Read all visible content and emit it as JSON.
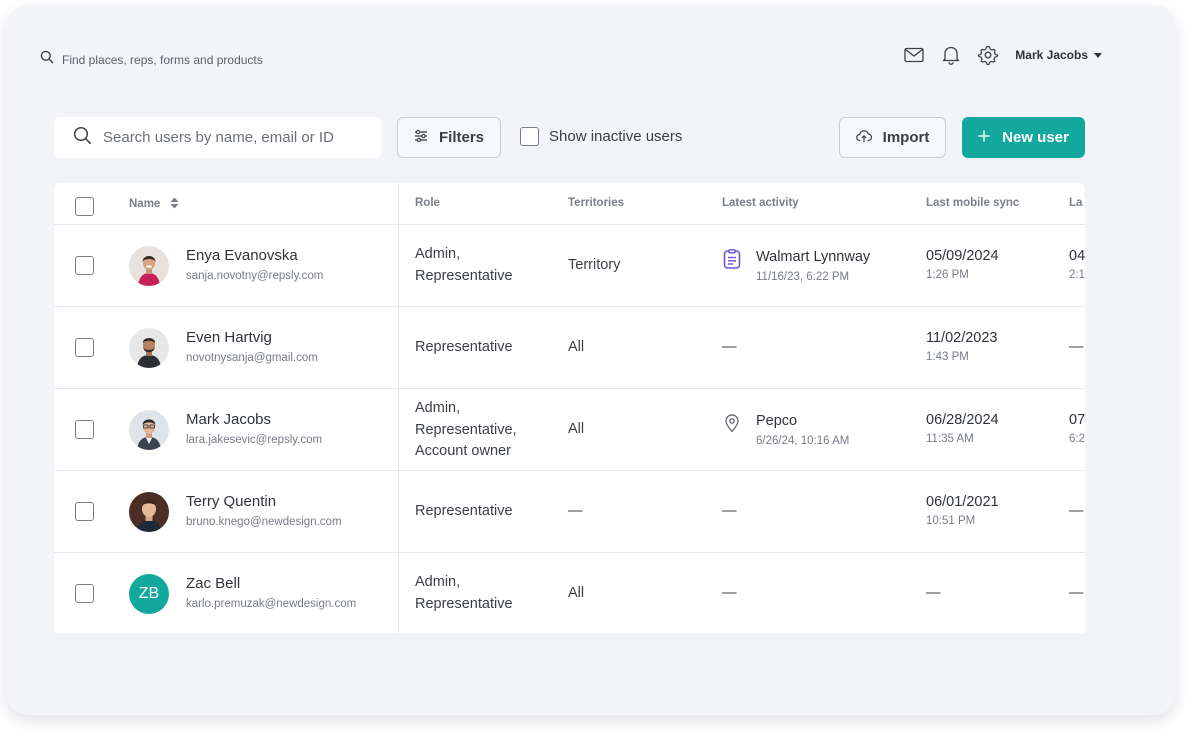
{
  "topbar": {
    "search_placeholder": "Find places, reps, forms and products",
    "user_name": "Mark Jacobs",
    "icons": [
      "mail-icon",
      "bell-icon",
      "gear-icon"
    ]
  },
  "toolbar": {
    "search_placeholder": "Search users by name, email or ID",
    "filters_label": "Filters",
    "inactive_label": "Show inactive users",
    "import_label": "Import",
    "new_user_label": "New user",
    "accent_color": "#13a89e"
  },
  "table": {
    "columns": {
      "name": "Name",
      "role": "Role",
      "territories": "Territories",
      "latest_activity": "Latest activity",
      "last_mobile_sync": "Last mobile sync",
      "last_col_partial": "La"
    },
    "rows": [
      {
        "name": "Enya Evanovska",
        "email": "sanja.novotny@repsly.com",
        "role_lines": [
          "Admin,",
          "Representative"
        ],
        "territories": "Territory",
        "activity": {
          "icon": "form-icon",
          "name": "Walmart Lynnway",
          "time": "11/16/23, 6:22 PM"
        },
        "sync": {
          "date": "05/09/2024",
          "time": "1:26 PM"
        },
        "last": {
          "date": "04",
          "time": "2:1"
        }
      },
      {
        "name": "Even Hartvig",
        "email": "novotnysanja@gmail.com",
        "role_lines": [
          "Representative"
        ],
        "territories": "All",
        "activity_dash": "—",
        "sync": {
          "date": "11/02/2023",
          "time": "1:43 PM"
        },
        "last_dash": "—"
      },
      {
        "name": "Mark Jacobs",
        "email": "lara.jakesevic@repsly.com",
        "role_lines": [
          "Admin,",
          "Representative,",
          "Account owner"
        ],
        "territories": "All",
        "activity": {
          "icon": "location-pin-icon",
          "name": "Pepco",
          "time": "6/26/24, 10:16 AM"
        },
        "sync": {
          "date": "06/28/2024",
          "time": "11:35 AM"
        },
        "last": {
          "date": "07",
          "time": "6:2"
        }
      },
      {
        "name": "Terry Quentin",
        "email": "bruno.knego@newdesign.com",
        "role_lines": [
          "Representative"
        ],
        "territories_dash": "—",
        "activity_dash": "—",
        "sync": {
          "date": "06/01/2021",
          "time": "10:51 PM"
        },
        "last_dash": "—"
      },
      {
        "name": "Zac Bell",
        "initials": "ZB",
        "email": "karlo.premuzak@newdesign.com",
        "role_lines": [
          "Admin,",
          "Representative"
        ],
        "territories": "All",
        "activity_dash": "—",
        "sync_dash": "—",
        "last_dash": "—"
      }
    ]
  }
}
